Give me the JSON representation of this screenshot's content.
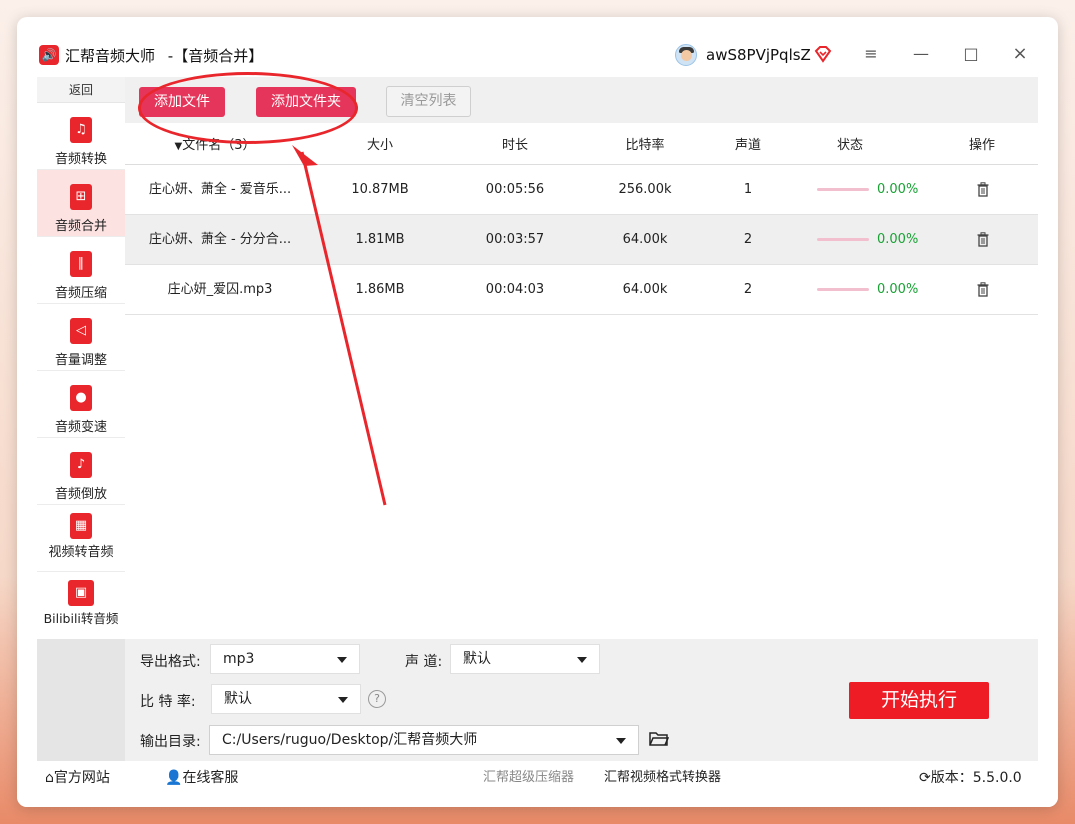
{
  "window": {
    "app_name": "汇帮音频大师",
    "page_title": "-【音频合并】",
    "username": "awS8PVjPqlsZ",
    "controls": [
      "≡",
      "—",
      "□",
      "×"
    ]
  },
  "sidebar": {
    "back_label": "返回",
    "items": [
      {
        "label": "音频转换",
        "icon": "audio-convert-icon"
      },
      {
        "label": "音频合并",
        "icon": "audio-merge-icon",
        "active": true
      },
      {
        "label": "音频压缩",
        "icon": "audio-compress-icon"
      },
      {
        "label": "音量调整",
        "icon": "volume-icon"
      },
      {
        "label": "音频变速",
        "icon": "mic-icon"
      },
      {
        "label": "音频倒放",
        "icon": "music-note-icon"
      },
      {
        "label": "视频转音频",
        "icon": "film-icon"
      },
      {
        "label": "Bilibili转音频",
        "icon": "bilibili-tv-icon"
      }
    ]
  },
  "toolbar": {
    "add_file": "添加文件",
    "add_folder": "添加文件夹",
    "clear_list": "清空列表"
  },
  "table": {
    "headers": {
      "name": "文件名（3）",
      "size": "大小",
      "duration": "时长",
      "bitrate": "比特率",
      "channel": "声道",
      "status": "状态",
      "action": "操作"
    },
    "rows": [
      {
        "name": "庄心妍、萧全 - 爱音乐...",
        "size": "10.87MB",
        "duration": "00:05:56",
        "bitrate": "256.00k",
        "channel": "1",
        "status": "0.00%",
        "progress": 0
      },
      {
        "name": "庄心妍、萧全 - 分分合...",
        "size": "1.81MB",
        "duration": "00:03:57",
        "bitrate": "64.00k",
        "channel": "2",
        "status": "0.00%",
        "progress": 0
      },
      {
        "name": "庄心妍_爱囚.mp3",
        "size": "1.86MB",
        "duration": "00:04:03",
        "bitrate": "64.00k",
        "channel": "2",
        "status": "0.00%",
        "progress": 0
      }
    ]
  },
  "settings": {
    "format_label": "导出格式:",
    "format_value": "mp3",
    "channel_label": "声 道:",
    "channel_value": "默认",
    "bitrate_label": "比 特 率:",
    "bitrate_value": "默认",
    "help": "?",
    "output_label": "输出目录:",
    "output_value": "C:/Users/ruguo/Desktop/汇帮音频大师",
    "start_button": "开始执行"
  },
  "footer": {
    "website": "官方网站",
    "support": "在线客服",
    "compressor": "汇帮超级压缩器",
    "video_converter": "汇帮视频格式转换器",
    "version_label": "版本：",
    "version": "5.5.0.0"
  },
  "colors": {
    "brand": "#e8262b",
    "button_pink": "#e5355a",
    "start": "#ee1c25",
    "status_green": "#18a334",
    "annotation": "#e8262b"
  }
}
